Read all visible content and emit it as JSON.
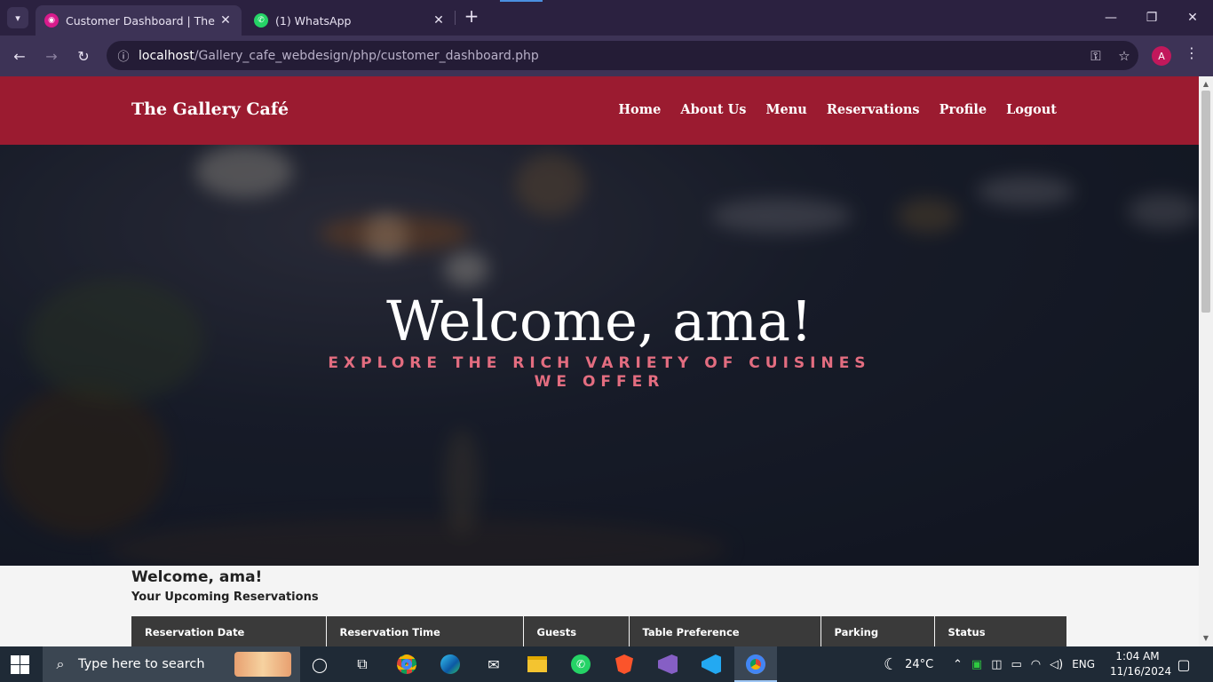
{
  "browser": {
    "tabs": [
      {
        "title": "Customer Dashboard | The Gallery Café",
        "active": true
      },
      {
        "title": "(1) WhatsApp",
        "active": false
      }
    ],
    "url_host": "localhost",
    "url_path": "/Gallery_cafe_webdesign/php/customer_dashboard.php",
    "profile_initial": "A"
  },
  "site": {
    "brand": "The Gallery Café",
    "nav": [
      "Home",
      "About Us",
      "Menu",
      "Reservations",
      "Profile",
      "Logout"
    ],
    "colors": {
      "header": "#9b1b30",
      "subtitle": "#e36d80",
      "table_header": "#3a3a3a"
    }
  },
  "hero": {
    "title": "Welcome, ama!",
    "subtitle": "Explore the rich variety of cuisines we offer"
  },
  "dashboard": {
    "welcome": "Welcome, ama!",
    "section_title": "Your Upcoming Reservations",
    "table_headers": [
      "Reservation Date",
      "Reservation Time",
      "Guests",
      "Table Preference",
      "Parking",
      "Status"
    ]
  },
  "taskbar": {
    "search_placeholder": "Type here to search",
    "weather": "24°C",
    "language": "ENG",
    "time": "1:04 AM",
    "date": "11/16/2024"
  }
}
